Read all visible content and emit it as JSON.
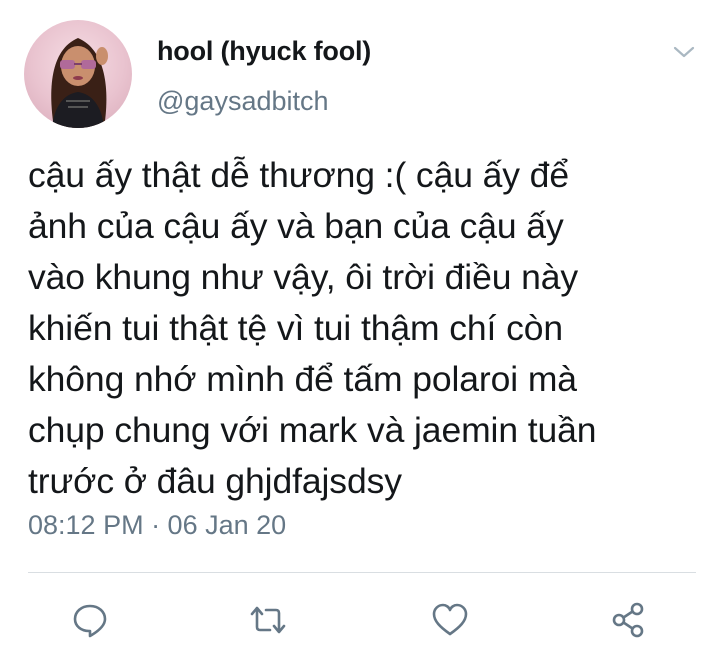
{
  "tweet": {
    "author": {
      "display_name": "hool (hyuck fool)",
      "handle": "@gaysadbitch",
      "avatar_icon": "profile-avatar"
    },
    "text_lines": [
      "cậu ấy thật dễ thương :( cậu ấy để",
      "ảnh của cậu ấy và bạn của cậu ấy",
      "vào khung như vậy, ôi trời điều này",
      "khiến tui thật tệ vì tui thậm chí còn",
      "không nhớ mình để tấm polaroi mà",
      "chụp chung với mark và jaemin tuần",
      "trước ở đâu ghjdfajsdsy"
    ],
    "timestamp": "08:12 PM · 06 Jan 20"
  },
  "actions": [
    {
      "name": "reply",
      "icon": "comment-icon"
    },
    {
      "name": "retweet",
      "icon": "retweet-icon"
    },
    {
      "name": "like",
      "icon": "heart-icon"
    },
    {
      "name": "share",
      "icon": "share-icon"
    }
  ],
  "colors": {
    "text_primary": "#14171a",
    "text_secondary": "#657786",
    "icon": "#657786",
    "divider": "#d9dee2"
  }
}
